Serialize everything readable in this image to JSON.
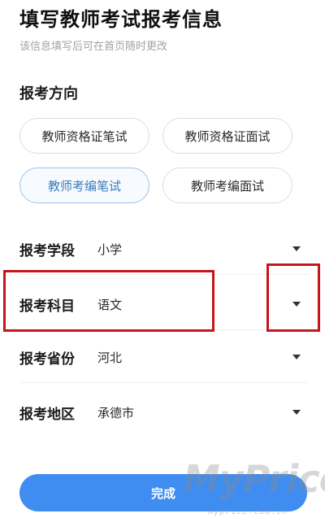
{
  "header": {
    "title": "填写教师考试报考信息",
    "subtitle": "该信息填写后可在首页随时更改"
  },
  "direction": {
    "heading": "报考方向",
    "options": [
      {
        "label": "教师资格证笔试",
        "selected": false
      },
      {
        "label": "教师资格证面试",
        "selected": false
      },
      {
        "label": "教师考编笔试",
        "selected": true
      },
      {
        "label": "教师考编面试",
        "selected": false
      }
    ]
  },
  "fields": [
    {
      "label": "报考学段",
      "value": "小学"
    },
    {
      "label": "报考科目",
      "value": "语文"
    },
    {
      "label": "报考省份",
      "value": "河北"
    },
    {
      "label": "报考地区",
      "value": "承德市"
    }
  ],
  "icons": {
    "dropdown": "caret-down-icon"
  },
  "colors": {
    "accent": "#3f8df0",
    "selected_text": "#3b7bbd",
    "highlight": "#c8141c"
  },
  "actions": {
    "done_label": "完成"
  },
  "watermark": {
    "text": "MyPrice",
    "sub": "myprice.com.cn"
  }
}
